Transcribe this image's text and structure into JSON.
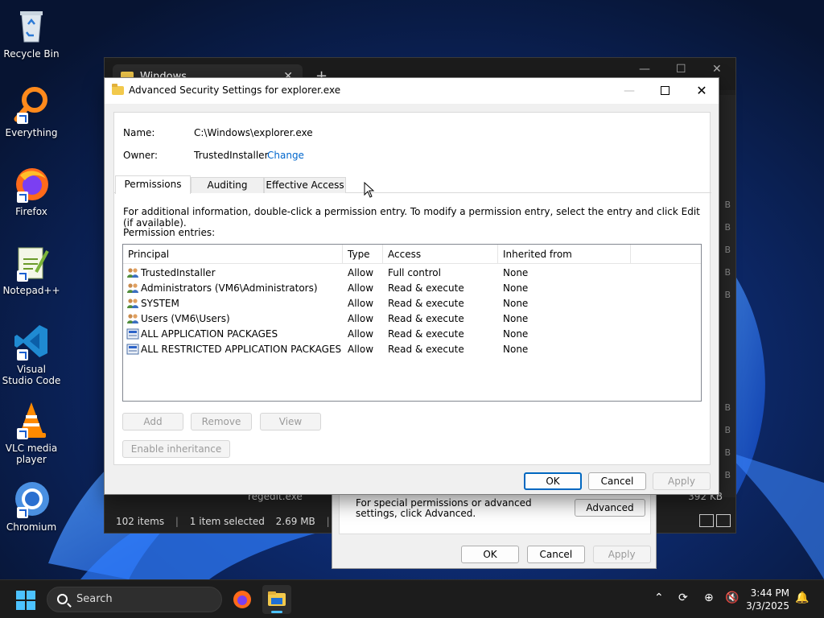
{
  "desktop": {
    "icons": [
      {
        "label": "Recycle Bin"
      },
      {
        "label": "Everything"
      },
      {
        "label": "Firefox"
      },
      {
        "label": "Notepad++"
      },
      {
        "label": "Visual Studio Code"
      },
      {
        "label": "VLC media player"
      },
      {
        "label": "Chromium"
      }
    ]
  },
  "explorer": {
    "tab_title": "Windows",
    "tab_close": "✕",
    "new_tab": "+",
    "status_items": "102 items",
    "status_selected": "1 item selected",
    "status_size": "2.69 MB",
    "separator": "|",
    "file_name": "regedit.exe",
    "file_size": "392 KB",
    "strip_letter": "B"
  },
  "properties": {
    "hint": "For special permissions or advanced settings, click Advanced.",
    "advanced_label": "Advanced",
    "ok_label": "OK",
    "cancel_label": "Cancel",
    "apply_label": "Apply"
  },
  "dialog": {
    "title": "Advanced Security Settings for explorer.exe",
    "name_label": "Name:",
    "name_value": "C:\\Windows\\explorer.exe",
    "owner_label": "Owner:",
    "owner_value": "TrustedInstaller",
    "change_link": "Change",
    "tabs": [
      {
        "label": "Permissions"
      },
      {
        "label": "Auditing"
      },
      {
        "label": "Effective Access"
      }
    ],
    "info": "For additional information, double-click a permission entry. To modify a permission entry, select the entry and click Edit (if available).",
    "entries_label": "Permission entries:",
    "columns": {
      "principal": "Principal",
      "type": "Type",
      "access": "Access",
      "inherited": "Inherited from"
    },
    "rows": [
      {
        "principal": "TrustedInstaller",
        "type": "Allow",
        "access": "Full control",
        "inherited": "None",
        "icon": "users-icon"
      },
      {
        "principal": "Administrators (VM6\\Administrators)",
        "type": "Allow",
        "access": "Read & execute",
        "inherited": "None",
        "icon": "users-icon"
      },
      {
        "principal": "SYSTEM",
        "type": "Allow",
        "access": "Read & execute",
        "inherited": "None",
        "icon": "users-icon"
      },
      {
        "principal": "Users (VM6\\Users)",
        "type": "Allow",
        "access": "Read & execute",
        "inherited": "None",
        "icon": "users-icon"
      },
      {
        "principal": "ALL APPLICATION PACKAGES",
        "type": "Allow",
        "access": "Read & execute",
        "inherited": "None",
        "icon": "package-icon"
      },
      {
        "principal": "ALL RESTRICTED APPLICATION PACKAGES",
        "type": "Allow",
        "access": "Read & execute",
        "inherited": "None",
        "icon": "package-icon"
      }
    ],
    "add_label": "Add",
    "remove_label": "Remove",
    "view_label": "View",
    "enable_inheritance_label": "Enable inheritance",
    "ok_label": "OK",
    "cancel_label": "Cancel",
    "apply_label": "Apply"
  },
  "taskbar": {
    "search_placeholder": "Search",
    "time": "3:44 PM",
    "date": "3/3/2025"
  },
  "colors": {
    "accent": "#0067c0",
    "link": "#0066cc",
    "folder": "#f2c94c",
    "taskbar": "#1c1c1c"
  }
}
